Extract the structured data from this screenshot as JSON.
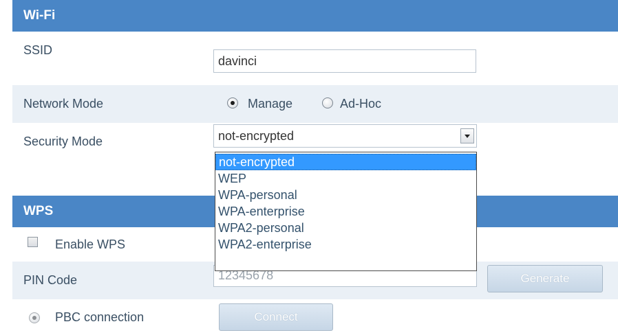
{
  "wifi": {
    "title": "Wi-Fi",
    "ssid_label": "SSID",
    "ssid_value": "davinci",
    "network_mode_label": "Network Mode",
    "network_mode_options": [
      "Manage",
      "Ad-Hoc"
    ],
    "network_mode_selected": "Manage",
    "security_mode_label": "Security Mode",
    "security_mode_value": "not-encrypted",
    "security_mode_options": [
      "not-encrypted",
      "WEP",
      "WPA-personal",
      "WPA-enterprise",
      "WPA2-personal",
      "WPA2-enterprise"
    ]
  },
  "wps": {
    "title": "WPS",
    "enable_label": "Enable WPS",
    "enabled": false,
    "pin_label": "PIN Code",
    "pin_value": "12345678",
    "generate_label": "Generate",
    "pbc_label": "PBC connection",
    "connect_label": "Connect"
  },
  "colors": {
    "header": "#4a86c6",
    "row_alt": "#eaf0f6",
    "dropdown_highlight": "#3399ff",
    "label_text": "#3a4f63"
  }
}
